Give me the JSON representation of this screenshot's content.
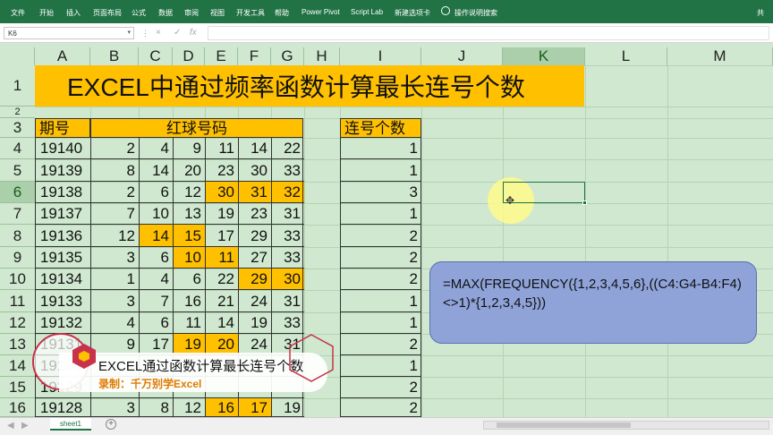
{
  "ribbon": {
    "tabs": [
      "文件",
      "开始",
      "插入",
      "页面布局",
      "公式",
      "数据",
      "审阅",
      "视图",
      "开发工具",
      "帮助",
      "Power Pivot",
      "Script Lab",
      "新建选项卡",
      "操作说明搜索"
    ],
    "share_label": "共"
  },
  "formula_bar": {
    "name_box": "K6",
    "cancel_icon": "×",
    "enter_icon": "✓",
    "fx_label": "fx",
    "content": ""
  },
  "columns": [
    "A",
    "B",
    "C",
    "D",
    "E",
    "F",
    "G",
    "H",
    "I",
    "J",
    "K",
    "L",
    "M"
  ],
  "selected_column": "K",
  "rows": [
    "1",
    "2",
    "3",
    "4",
    "5",
    "6",
    "7",
    "8",
    "9",
    "10",
    "11",
    "12",
    "13",
    "14",
    "15",
    "16"
  ],
  "selected_row": "6",
  "sheet_title": "EXCEL中通过频率函数计算最长连号个数",
  "headers": {
    "period": "期号",
    "red_balls": "红球号码",
    "consecutive": "连号个数"
  },
  "table": [
    {
      "period": "19140",
      "balls": [
        "2",
        "4",
        "9",
        "11",
        "14",
        "22"
      ],
      "hl": [],
      "count": "1"
    },
    {
      "period": "19139",
      "balls": [
        "8",
        "14",
        "20",
        "23",
        "30",
        "33"
      ],
      "hl": [],
      "count": "1"
    },
    {
      "period": "19138",
      "balls": [
        "2",
        "6",
        "12",
        "30",
        "31",
        "32"
      ],
      "hl": [
        3,
        4,
        5
      ],
      "count": "3"
    },
    {
      "period": "19137",
      "balls": [
        "7",
        "10",
        "13",
        "19",
        "23",
        "31"
      ],
      "hl": [],
      "count": "1"
    },
    {
      "period": "19136",
      "balls": [
        "12",
        "14",
        "15",
        "17",
        "29",
        "33"
      ],
      "hl": [
        1,
        2
      ],
      "count": "2"
    },
    {
      "period": "19135",
      "balls": [
        "3",
        "6",
        "10",
        "11",
        "27",
        "33"
      ],
      "hl": [
        2,
        3
      ],
      "count": "2"
    },
    {
      "period": "19134",
      "balls": [
        "1",
        "4",
        "6",
        "22",
        "29",
        "30"
      ],
      "hl": [
        4,
        5
      ],
      "count": "2"
    },
    {
      "period": "19133",
      "balls": [
        "3",
        "7",
        "16",
        "21",
        "24",
        "31"
      ],
      "hl": [],
      "count": "1"
    },
    {
      "period": "19132",
      "balls": [
        "4",
        "6",
        "11",
        "14",
        "19",
        "33"
      ],
      "hl": [],
      "count": "1"
    },
    {
      "period": "19131",
      "balls": [
        "9",
        "17",
        "19",
        "20",
        "24",
        "31"
      ],
      "hl": [
        2,
        3
      ],
      "count": "2"
    },
    {
      "period": "19130",
      "balls": [
        "",
        "",
        "",
        "",
        "",
        ""
      ],
      "hl": [],
      "count": "1"
    },
    {
      "period": "19129",
      "balls": [
        "",
        "",
        "",
        "",
        "",
        ""
      ],
      "hl": [],
      "count": "2"
    },
    {
      "period": "19128",
      "balls": [
        "3",
        "8",
        "12",
        "16",
        "17",
        "19"
      ],
      "hl": [
        3,
        4
      ],
      "count": "2"
    }
  ],
  "formula_note": "=MAX(FREQUENCY({1,2,3,4,5,6},((C4:G4-B4:F4)<>1)*{1,2,3,4,5}))",
  "overlay": {
    "title": "EXCEL通过函数计算最长连号个数",
    "subtitle": "录制：千万别学Excel"
  },
  "sheet_tabs": [
    "sheet1"
  ],
  "add_sheet_label": "+",
  "colors": {
    "ribbon": "#217346",
    "highlight": "#ffc000",
    "background": "#cfe8cf",
    "note": "#8fa3d9"
  }
}
